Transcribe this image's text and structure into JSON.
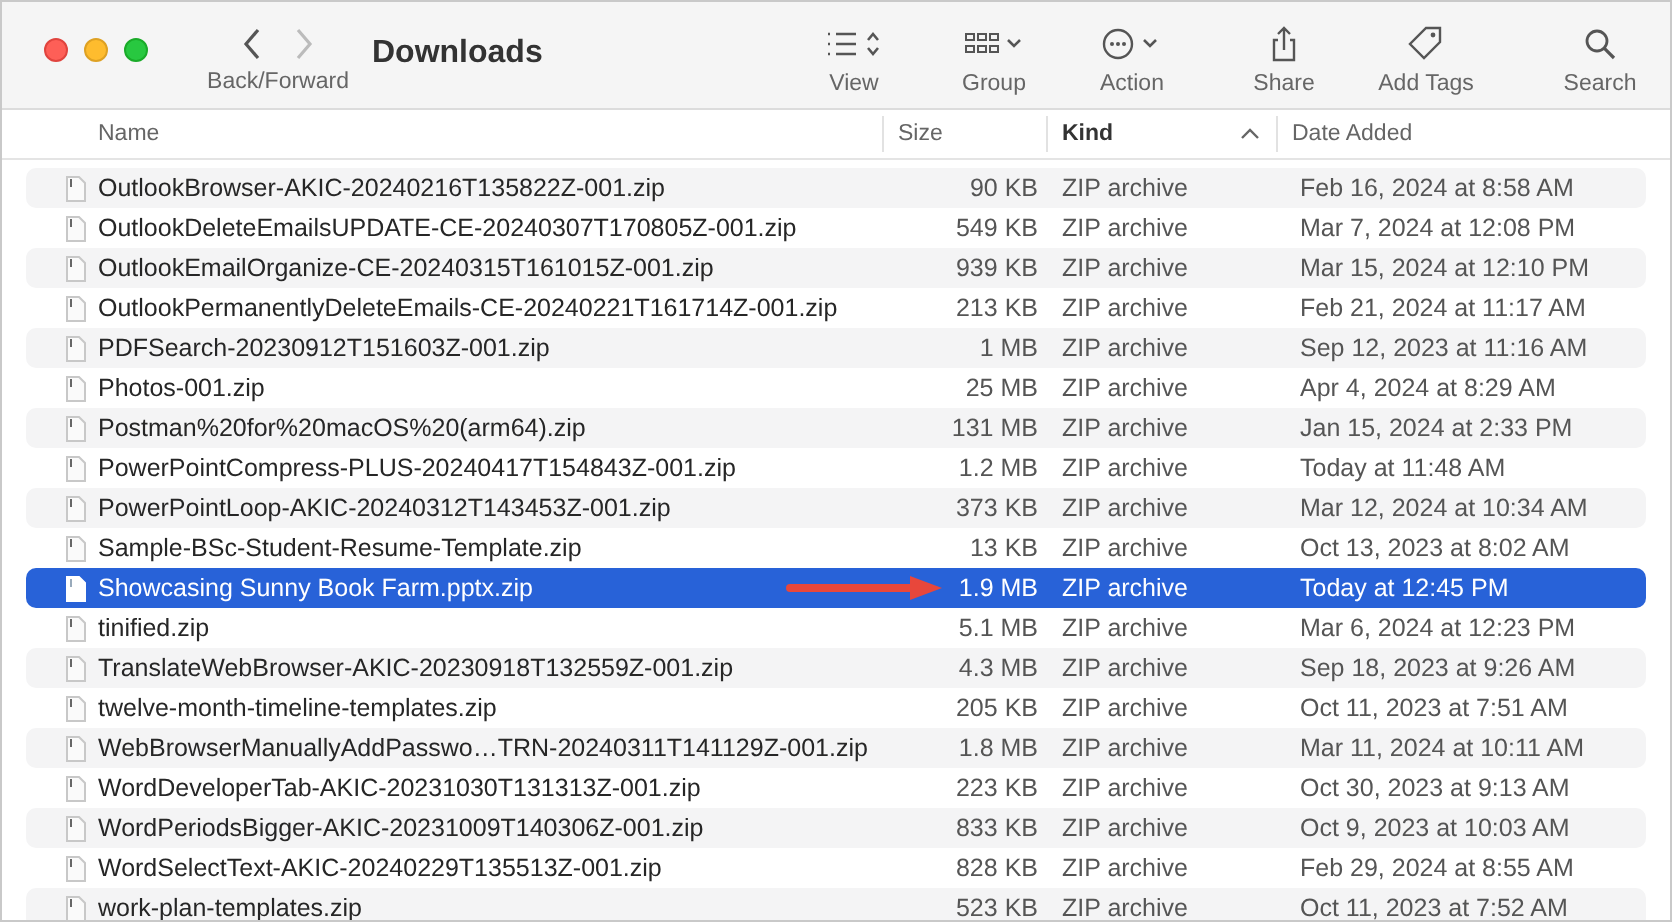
{
  "window": {
    "title": "Downloads"
  },
  "toolbar": {
    "nav_label": "Back/Forward",
    "items": [
      {
        "kind": "view",
        "label": "View"
      },
      {
        "kind": "group",
        "label": "Group"
      },
      {
        "kind": "action",
        "label": "Action"
      },
      {
        "kind": "share",
        "label": "Share"
      },
      {
        "kind": "tags",
        "label": "Add Tags"
      },
      {
        "kind": "search",
        "label": "Search"
      }
    ]
  },
  "columns": [
    {
      "label": "Name",
      "sorted": false
    },
    {
      "label": "Size",
      "sorted": false
    },
    {
      "label": "Kind",
      "sorted": true
    },
    {
      "label": "Date Added",
      "sorted": false
    }
  ],
  "rows": [
    {
      "name": "OutlookBrowser-AKIC-20240216T135822Z-001.zip",
      "size": "90 KB",
      "kind": "ZIP archive",
      "date": "Feb 16, 2024 at 8:58 AM",
      "selected": false,
      "marked": false
    },
    {
      "name": "OutlookDeleteEmailsUPDATE-CE-20240307T170805Z-001.zip",
      "size": "549 KB",
      "kind": "ZIP archive",
      "date": "Mar 7, 2024 at 12:08 PM",
      "selected": false,
      "marked": false
    },
    {
      "name": "OutlookEmailOrganize-CE-20240315T161015Z-001.zip",
      "size": "939 KB",
      "kind": "ZIP archive",
      "date": "Mar 15, 2024 at 12:10 PM",
      "selected": false,
      "marked": false
    },
    {
      "name": "OutlookPermanentlyDeleteEmails-CE-20240221T161714Z-001.zip",
      "size": "213 KB",
      "kind": "ZIP archive",
      "date": "Feb 21, 2024 at 11:17 AM",
      "selected": false,
      "marked": false
    },
    {
      "name": "PDFSearch-20230912T151603Z-001.zip",
      "size": "1 MB",
      "kind": "ZIP archive",
      "date": "Sep 12, 2023 at 11:16 AM",
      "selected": false,
      "marked": false
    },
    {
      "name": "Photos-001.zip",
      "size": "25 MB",
      "kind": "ZIP archive",
      "date": "Apr 4, 2024 at 8:29 AM",
      "selected": false,
      "marked": false
    },
    {
      "name": "Postman%20for%20macOS%20(arm64).zip",
      "size": "131 MB",
      "kind": "ZIP archive",
      "date": "Jan 15, 2024 at 2:33 PM",
      "selected": false,
      "marked": false
    },
    {
      "name": "PowerPointCompress-PLUS-20240417T154843Z-001.zip",
      "size": "1.2 MB",
      "kind": "ZIP archive",
      "date": "Today at 11:48 AM",
      "selected": false,
      "marked": false
    },
    {
      "name": "PowerPointLoop-AKIC-20240312T143453Z-001.zip",
      "size": "373 KB",
      "kind": "ZIP archive",
      "date": "Mar 12, 2024 at 10:34 AM",
      "selected": false,
      "marked": false
    },
    {
      "name": "Sample-BSc-Student-Resume-Template.zip",
      "size": "13 KB",
      "kind": "ZIP archive",
      "date": "Oct 13, 2023 at 8:02 AM",
      "selected": false,
      "marked": false
    },
    {
      "name": "Showcasing Sunny Book Farm.pptx.zip",
      "size": "1.9 MB",
      "kind": "ZIP archive",
      "date": "Today at 12:45 PM",
      "selected": true,
      "marked": true
    },
    {
      "name": "tinified.zip",
      "size": "5.1 MB",
      "kind": "ZIP archive",
      "date": "Mar 6, 2024 at 12:23 PM",
      "selected": false,
      "marked": false
    },
    {
      "name": "TranslateWebBrowser-AKIC-20230918T132559Z-001.zip",
      "size": "4.3 MB",
      "kind": "ZIP archive",
      "date": "Sep 18, 2023 at 9:26 AM",
      "selected": false,
      "marked": false
    },
    {
      "name": "twelve-month-timeline-templates.zip",
      "size": "205 KB",
      "kind": "ZIP archive",
      "date": "Oct 11, 2023 at 7:51 AM",
      "selected": false,
      "marked": false
    },
    {
      "name": "WebBrowserManuallyAddPasswo…TRN-20240311T141129Z-001.zip",
      "size": "1.8 MB",
      "kind": "ZIP archive",
      "date": "Mar 11, 2024 at 10:11 AM",
      "selected": false,
      "marked": false
    },
    {
      "name": "WordDeveloperTab-AKIC-20231030T131313Z-001.zip",
      "size": "223 KB",
      "kind": "ZIP archive",
      "date": "Oct 30, 2023 at 9:13 AM",
      "selected": false,
      "marked": false
    },
    {
      "name": "WordPeriodsBigger-AKIC-20231009T140306Z-001.zip",
      "size": "833 KB",
      "kind": "ZIP archive",
      "date": "Oct 9, 2023 at 10:03 AM",
      "selected": false,
      "marked": false
    },
    {
      "name": "WordSelectText-AKIC-20240229T135513Z-001.zip",
      "size": "828 KB",
      "kind": "ZIP archive",
      "date": "Feb 29, 2024 at 8:55 AM",
      "selected": false,
      "marked": false
    },
    {
      "name": "work-plan-templates.zip",
      "size": "523 KB",
      "kind": "ZIP archive",
      "date": "Oct 11, 2023 at 7:52 AM",
      "selected": false,
      "marked": false
    }
  ]
}
